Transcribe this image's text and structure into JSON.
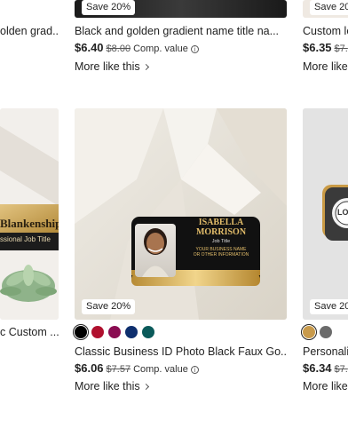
{
  "row1": {
    "left": {
      "title": "olden grad..."
    },
    "center": {
      "badge": "Save 20%",
      "title": "Black and golden gradient name title na...",
      "price": "$6.40",
      "was": "$8.00",
      "comp": "Comp. value",
      "more": "More like this"
    },
    "right": {
      "badge": "Save 20",
      "title": "Custom lo",
      "price": "$6.35",
      "was": "$7.",
      "more": "More like"
    }
  },
  "row2": {
    "left": {
      "title": "c Custom ...",
      "tag_name": "Blankenship",
      "tag_sub": "ssional Job Title"
    },
    "center": {
      "badge": "Save 20%",
      "title": "Classic Business ID Photo Black Faux Go...",
      "price": "$6.06",
      "was": "$7.57",
      "comp": "Comp. value",
      "more": "More like this",
      "swatches": [
        "#000000",
        "#b0102e",
        "#8a0d52",
        "#0e2f6e",
        "#0b5a5a"
      ],
      "tag_name": "ISABELLA\nMORRISON",
      "tag_job": "Job Title",
      "tag_info": "YOUR BUSINESS NAME\nOR OTHER INFORMATION"
    },
    "right": {
      "badge": "Save 20",
      "title": "Personali",
      "price": "$6.34",
      "was": "$7.",
      "more": "More like",
      "swatches": [
        "#c89a4b",
        "#6b6b6b"
      ],
      "logo_text": "LO"
    }
  }
}
